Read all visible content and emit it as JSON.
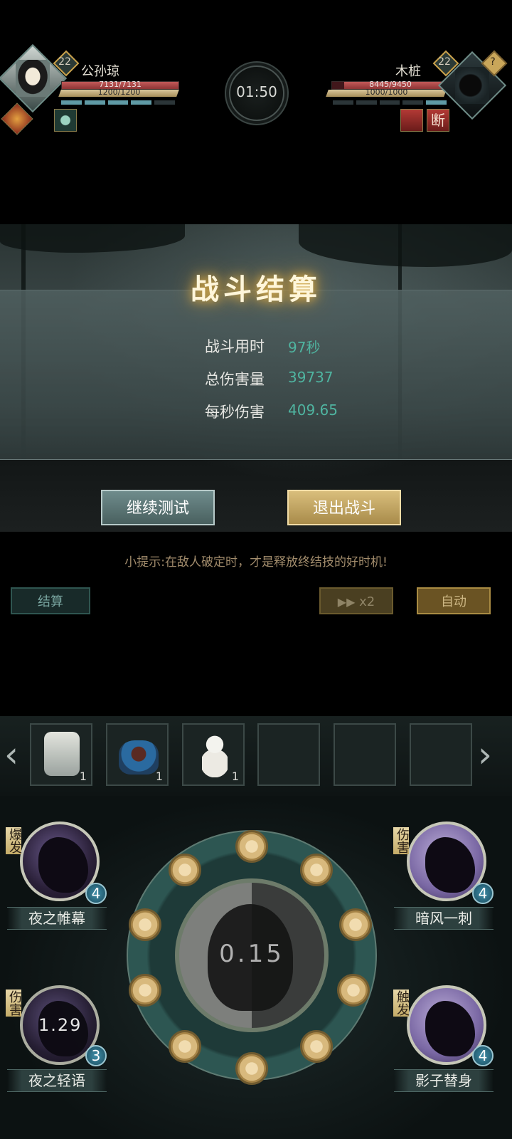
{
  "hud": {
    "player": {
      "name": "公孙琼",
      "level": "22",
      "hp_text": "7131/7131",
      "mp_text": "1200/1200",
      "hp_ratio": 1.0,
      "mp_ratio": 1.0
    },
    "enemy": {
      "name": "木桩",
      "level": "22",
      "hp_text": "8445/9450",
      "mp_text": "1000/1000",
      "hp_ratio": 0.894,
      "mp_ratio": 1.0,
      "unknown_badge": "?",
      "debuff_break": "断"
    },
    "timer": "01:50"
  },
  "result": {
    "title": "战斗结算",
    "stats": [
      {
        "label": "战斗用时",
        "value": "97秒"
      },
      {
        "label": "总伤害量",
        "value": "39737"
      },
      {
        "label": "每秒伤害",
        "value": "409.65"
      }
    ],
    "continue_label": "继续测试",
    "exit_label": "退出战斗"
  },
  "tip": "小提示:在敌人破定时，才是释放终结技的好时机!",
  "controls": {
    "settle_label": "结算",
    "speed_label": "x2",
    "auto_label": "自动"
  },
  "items": [
    {
      "icon": "seal-jar-icon",
      "count": "1"
    },
    {
      "icon": "incense-bowl-icon",
      "count": "1"
    },
    {
      "icon": "gourd-bottle-icon",
      "count": "1"
    },
    {
      "icon": "",
      "count": ""
    },
    {
      "icon": "",
      "count": ""
    },
    {
      "icon": "",
      "count": ""
    }
  ],
  "wheel": {
    "cooldown": "0.15"
  },
  "skills": {
    "top_left": {
      "name": "夜之帷幕",
      "tag": "爆发",
      "count": "4"
    },
    "top_right": {
      "name": "暗风一刺",
      "tag": "伤害",
      "count": "4"
    },
    "bottom_left": {
      "name": "夜之轻语",
      "tag": "伤害",
      "count": "3",
      "cooldown": "1.29"
    },
    "bottom_right": {
      "name": "影子替身",
      "tag": "触发",
      "count": "4"
    }
  },
  "colors": {
    "accent_teal": "#4fb4a0",
    "gold": "#c9a14b",
    "hp_red": "#c35a59"
  }
}
